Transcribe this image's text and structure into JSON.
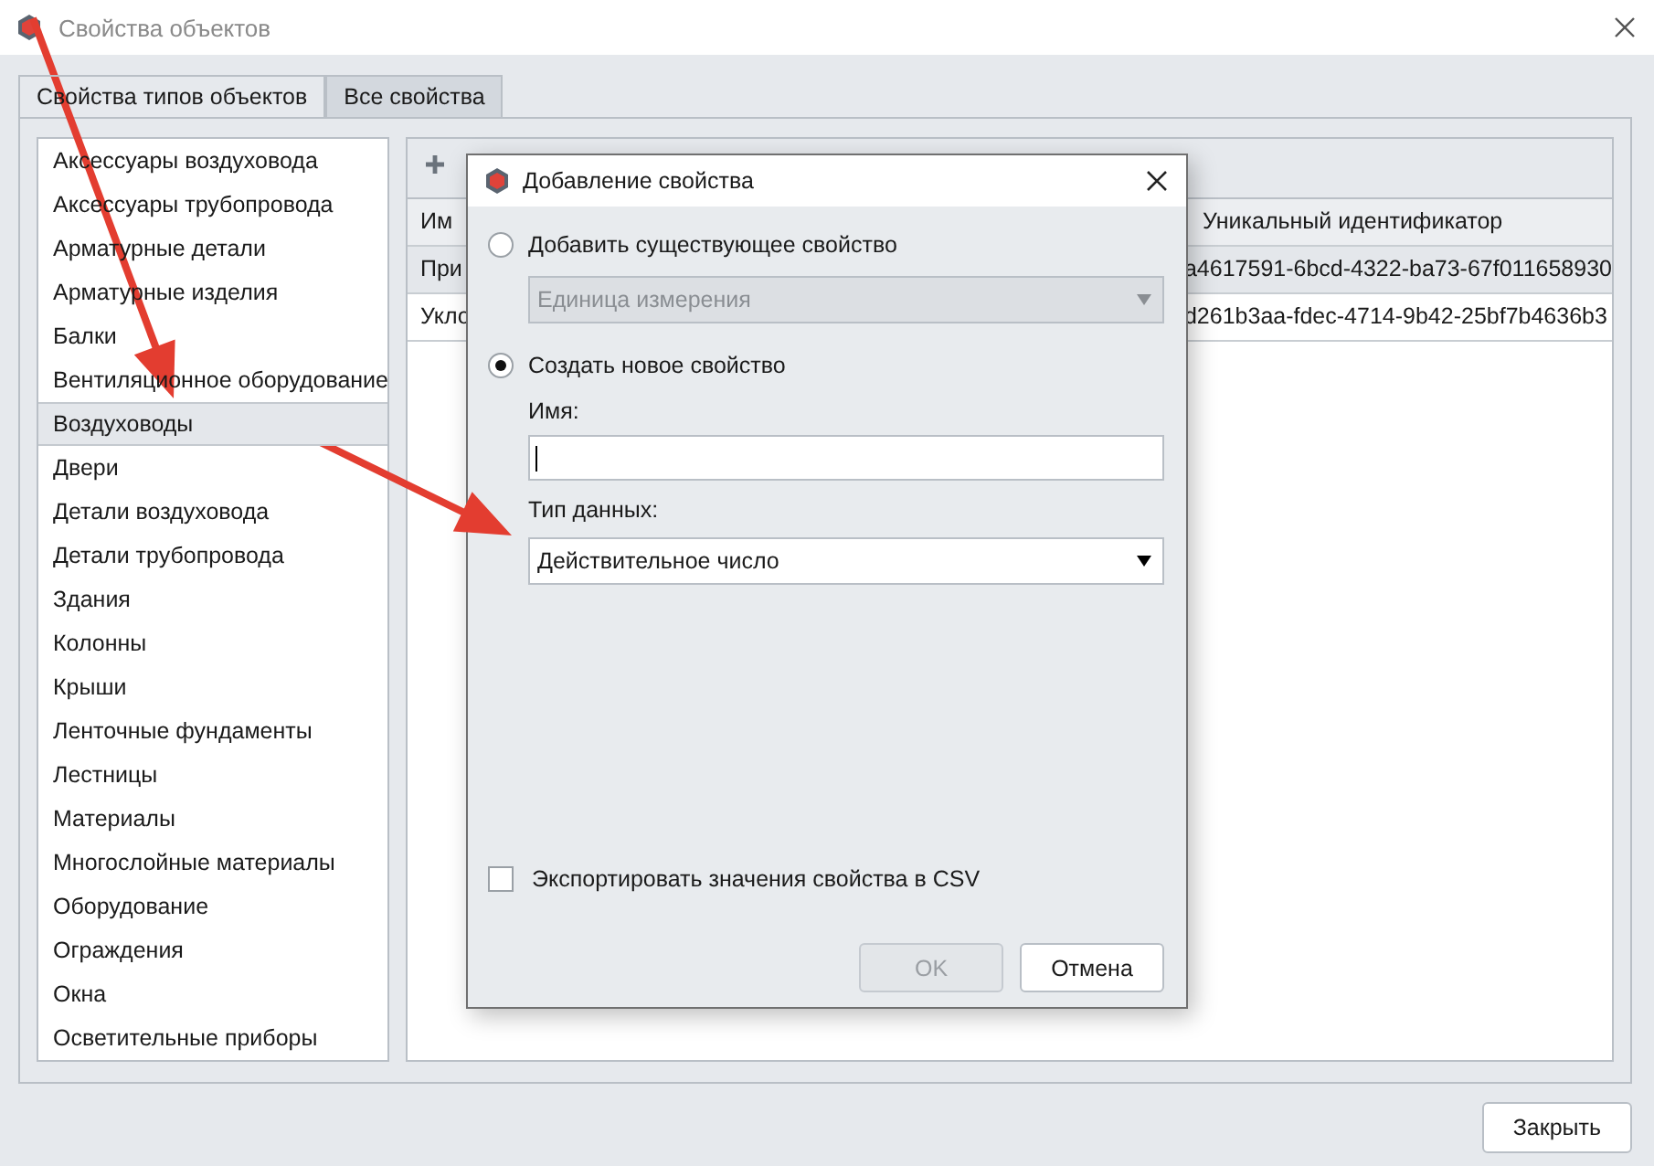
{
  "window": {
    "title": "Свойства объектов"
  },
  "tabs": [
    {
      "label": "Свойства типов объектов",
      "selected": true
    },
    {
      "label": "Все свойства",
      "selected": false
    }
  ],
  "object_types": [
    {
      "label": "Аксессуары воздуховода",
      "selected": false
    },
    {
      "label": "Аксессуары трубопровода",
      "selected": false
    },
    {
      "label": "Арматурные детали",
      "selected": false
    },
    {
      "label": "Арматурные изделия",
      "selected": false
    },
    {
      "label": "Балки",
      "selected": false
    },
    {
      "label": "Вентиляционное оборудование",
      "selected": false
    },
    {
      "label": "Воздуховоды",
      "selected": true
    },
    {
      "label": "Двери",
      "selected": false
    },
    {
      "label": "Детали воздуховода",
      "selected": false
    },
    {
      "label": "Детали трубопровода",
      "selected": false
    },
    {
      "label": "Здания",
      "selected": false
    },
    {
      "label": "Колонны",
      "selected": false
    },
    {
      "label": "Крыши",
      "selected": false
    },
    {
      "label": "Ленточные фундаменты",
      "selected": false
    },
    {
      "label": "Лестницы",
      "selected": false
    },
    {
      "label": "Материалы",
      "selected": false
    },
    {
      "label": "Многослойные материалы",
      "selected": false
    },
    {
      "label": "Оборудование",
      "selected": false
    },
    {
      "label": "Ограждения",
      "selected": false
    },
    {
      "label": "Окна",
      "selected": false
    },
    {
      "label": "Осветительные приборы",
      "selected": false
    }
  ],
  "table": {
    "columns": [
      "Им",
      "Уникальный идентификатор"
    ],
    "rows": [
      {
        "cells": [
          "При",
          "a4617591-6bcd-4322-ba73-67f011658930"
        ],
        "selected": true
      },
      {
        "cells": [
          "Укло",
          "d261b3aa-fdec-4714-9b42-25bf7b4636b3"
        ],
        "selected": false
      }
    ]
  },
  "dialog": {
    "title": "Добавление свойства",
    "options": [
      {
        "label": "Добавить существующее свойство",
        "selected": false
      },
      {
        "label": "Создать новое свойство",
        "selected": true
      }
    ],
    "existing_select": {
      "value": "Единица измерения",
      "disabled": true
    },
    "name_field": {
      "label": "Имя:"
    },
    "data_type": {
      "label": "Тип данных:",
      "value": "Действительное число",
      "disabled": false
    },
    "export_checkbox": {
      "label": "Экспортировать значения свойства в CSV",
      "checked": false
    },
    "buttons": [
      {
        "label": "OK",
        "disabled": true
      },
      {
        "label": "Отмена",
        "disabled": false
      }
    ]
  },
  "close_button": "Закрыть"
}
